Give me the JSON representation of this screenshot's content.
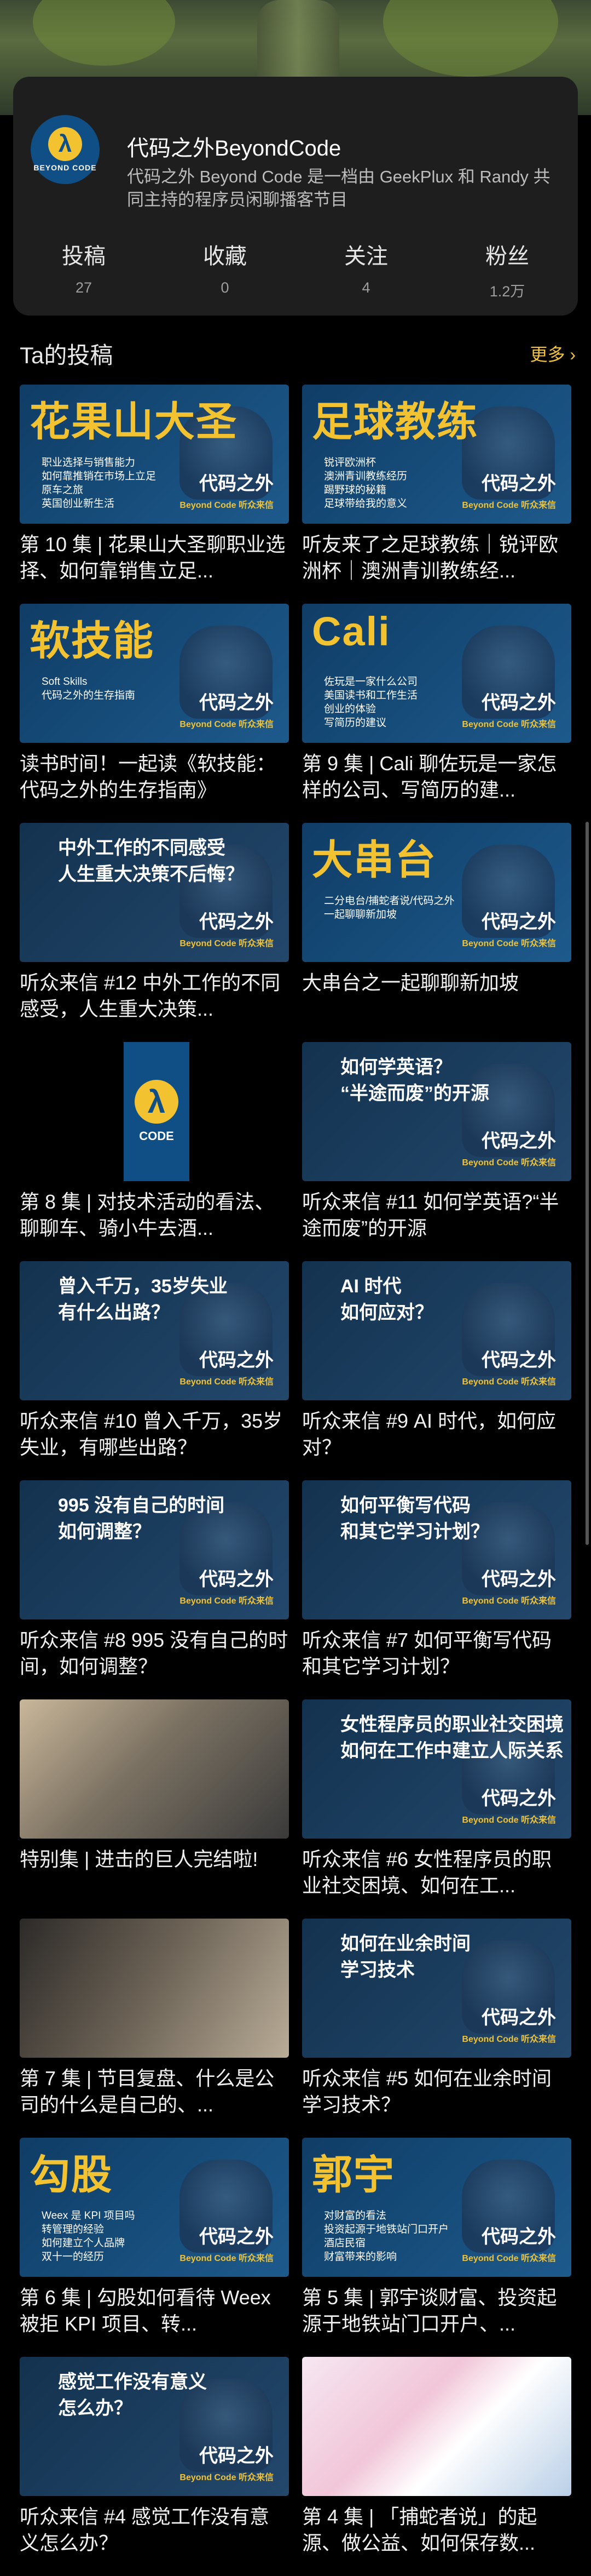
{
  "profile": {
    "name": "代码之外BeyondCode",
    "bio": "代码之外 Beyond Code 是一档由 GeekPlux 和 Randy 共同主持的程序员闲聊播客节目",
    "avatar_text": "BEYOND CODE",
    "stats": [
      {
        "label": "投稿",
        "value": "27"
      },
      {
        "label": "收藏",
        "value": "0"
      },
      {
        "label": "关注",
        "value": "4"
      },
      {
        "label": "粉丝",
        "value": "1.2万"
      }
    ]
  },
  "section": {
    "title": "Ta的投稿",
    "more": "更多 ›"
  },
  "posts": [
    {
      "title": "第 10 集 | 花果山大圣聊职业选择、如何靠销售立足...",
      "thumb_big": "花果山大圣",
      "thumb_lines": [
        "职业选择与销售能力",
        "如何靠推销在市场上立足",
        "原车之旅",
        "英国创业新生活"
      ],
      "brand": "代码之外"
    },
    {
      "title": "听友来了之足球教练｜锐评欧洲杯｜澳洲青训教练经...",
      "thumb_big": "足球教练",
      "thumb_lines": [
        "锐评欧洲杯",
        "澳洲青训教练经历",
        "踢野球的秘籍",
        "足球带给我的意义"
      ],
      "brand": "代码之外"
    },
    {
      "title": "读书时间！一起读《软技能：代码之外的生存指南》",
      "thumb_big": "软技能",
      "thumb_lines": [
        "Soft Skills",
        "代码之外的生存指南"
      ],
      "brand": "代码之外"
    },
    {
      "title": "第 9 集 | Cali 聊佐玩是一家怎样的公司、写简历的建...",
      "thumb_big": "Cali",
      "thumb_lines": [
        "佐玩是一家什么公司",
        "美国读书和工作生活",
        "创业的体验",
        "写简历的建议"
      ],
      "brand": "代码之外"
    },
    {
      "title": "听众来信 #12 中外工作的不同感受，人生重大决策...",
      "thumb_q": [
        "中外工作的不同感受",
        "人生重大决策不后悔？"
      ],
      "brand": "代码之外"
    },
    {
      "title": "大串台之一起聊聊新加坡",
      "thumb_big": "大串台",
      "thumb_lines": [
        "二分电台/捕蛇者说/代码之外",
        "一起聊聊新加坡"
      ],
      "brand": "代码之外"
    },
    {
      "title": "第 8 集 | 对技术活动的看法、聊聊车、骑小牛去酒...",
      "logo": "CODE",
      "brand": ""
    },
    {
      "title": "听众来信 #11 如何学英语?“半途而废”的开源",
      "thumb_q": [
        "如何学英语？",
        "“半途而废”的开源"
      ],
      "brand": "代码之外"
    },
    {
      "title": "听众来信 #10 曾入千万，35岁失业，有哪些出路？",
      "thumb_q": [
        "曾入千万，35岁失业",
        "有什么出路？"
      ],
      "brand": "代码之外"
    },
    {
      "title": "听众来信 #9 AI 时代，如何应对？",
      "thumb_q": [
        "AI 时代",
        "如何应对？"
      ],
      "brand": "代码之外"
    },
    {
      "title": "听众来信 #8 995 没有自己的时间，如何调整？",
      "thumb_q": [
        "995 没有自己的时间",
        "如何调整？"
      ],
      "brand": "代码之外"
    },
    {
      "title": "听众来信 #7 如何平衡写代码和其它学习计划？",
      "thumb_q": [
        "如何平衡写代码",
        "和其它学习计划？"
      ],
      "brand": "代码之外"
    },
    {
      "title": "特别集 | 进击的巨人完结啦!",
      "photo": true,
      "brand": ""
    },
    {
      "title": "听众来信 #6 女性程序员的职业社交困境、如何在工...",
      "thumb_q": [
        "女性程序员的职业社交困境",
        "如何在工作中建立人际关系"
      ],
      "brand": "代码之外"
    },
    {
      "title": "第 7 集 | 节目复盘、什么是公司的什么是自己的、...",
      "photo": true,
      "brand": ""
    },
    {
      "title": "听众来信 #5 如何在业余时间学习技术？",
      "thumb_q": [
        "如何在业余时间",
        "学习技术"
      ],
      "brand": "代码之外"
    },
    {
      "title": "第 6 集 | 勾股如何看待 Weex 被拒 KPI 项目、转...",
      "thumb_big": "勾股",
      "thumb_lines": [
        "Weex 是 KPI 项目吗",
        "转管理的经验",
        "如何建立个人品牌",
        "双十一的经历"
      ],
      "brand": "代码之外"
    },
    {
      "title": "第 5 集 | 郭宇谈财富、投资起源于地铁站门口开户、...",
      "thumb_big": "郭宇",
      "thumb_lines": [
        "对财富的看法",
        "投资起源于地铁站门口开户",
        "酒店民宿",
        "财富带来的影响"
      ],
      "brand": "代码之外"
    },
    {
      "title": "听众来信 #4 感觉工作没有意义怎么办？",
      "thumb_q": [
        "感觉工作没有意义",
        "怎么办？"
      ],
      "brand": "代码之外"
    },
    {
      "title": "第 4 集 | 「捕蛇者说」的起源、做公益、如何保存数...",
      "anime": true,
      "brand": ""
    }
  ],
  "thumb_sub": "Beyond Code 听众来信"
}
